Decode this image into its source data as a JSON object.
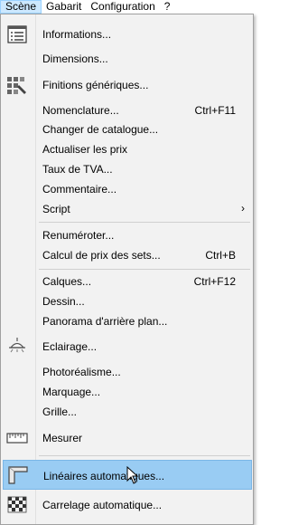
{
  "menubar": {
    "items": [
      "Scène",
      "Gabarit",
      "Configuration",
      "?"
    ]
  },
  "menu": {
    "items": [
      {
        "label": "Informations...",
        "shortcut": "",
        "icon": "list-icon"
      },
      {
        "label": "Dimensions...",
        "shortcut": "",
        "icon": ""
      },
      {
        "label": "Finitions génériques...",
        "shortcut": "",
        "icon": "grid-brush-icon"
      },
      {
        "label": "Nomenclature...",
        "shortcut": "Ctrl+F11",
        "icon": ""
      },
      {
        "label": "Changer de catalogue...",
        "shortcut": "",
        "icon": ""
      },
      {
        "label": "Actualiser les prix",
        "shortcut": "",
        "icon": ""
      },
      {
        "label": "Taux de TVA...",
        "shortcut": "",
        "icon": ""
      },
      {
        "label": "Commentaire...",
        "shortcut": "",
        "icon": ""
      },
      {
        "label": "Script",
        "shortcut": "",
        "icon": "",
        "submenu": true
      },
      {
        "label": "Renuméroter...",
        "shortcut": "",
        "icon": ""
      },
      {
        "label": "Calcul de prix des sets...",
        "shortcut": "Ctrl+B",
        "icon": ""
      },
      {
        "label": "Calques...",
        "shortcut": "Ctrl+F12",
        "icon": ""
      },
      {
        "label": "Dessin...",
        "shortcut": "",
        "icon": ""
      },
      {
        "label": "Panorama d'arrière plan...",
        "shortcut": "",
        "icon": ""
      },
      {
        "label": "Eclairage...",
        "shortcut": "",
        "icon": "ceiling-lamp-icon"
      },
      {
        "label": "Photoréalisme...",
        "shortcut": "",
        "icon": ""
      },
      {
        "label": "Marquage...",
        "shortcut": "",
        "icon": ""
      },
      {
        "label": "Grille...",
        "shortcut": "",
        "icon": ""
      },
      {
        "label": "Mesurer",
        "shortcut": "",
        "icon": "ruler-icon"
      },
      {
        "label": "Linéaires automatiques...",
        "shortcut": "",
        "icon": "worktop-icon"
      },
      {
        "label": "Carrelage automatique...",
        "shortcut": "",
        "icon": "checker-tile-icon"
      }
    ]
  },
  "colors": {
    "hover_bg": "#99ccf3",
    "menubar_active": "#cce8ff",
    "menu_bg": "#f2f2f2"
  }
}
